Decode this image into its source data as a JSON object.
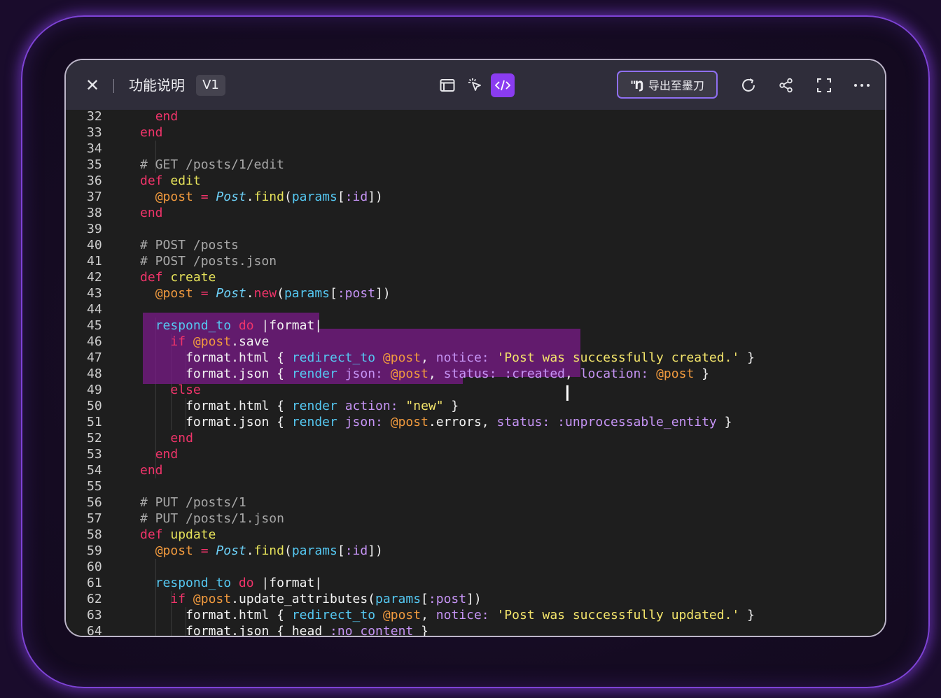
{
  "app": {
    "title": "功能说明",
    "version": "V1",
    "export_label": "导出至墨刀",
    "export_logo": "\"Ŋ",
    "close_glyph": "✕"
  },
  "toolbar_icons": [
    "preview-icon",
    "select-cursor-icon",
    "code-view-icon",
    "refresh-icon",
    "share-icon",
    "fullscreen-icon",
    "more-icon"
  ],
  "colors": {
    "accent": "#8a3cf0",
    "keyword": "#f0346a",
    "method": "#e6e25a",
    "instance_var": "#f19a3e",
    "constant": "#6ccff6",
    "comment": "#a8a8a8",
    "symbol": "#c694f5",
    "string": "#f4e56b",
    "hash_key": "#55c8f2",
    "selection": "#7d1a8c"
  },
  "code_lines": [
    {
      "n": "32",
      "indent": 2,
      "tokens": [
        [
          "kw",
          "end"
        ]
      ]
    },
    {
      "n": "33",
      "indent": 1,
      "tokens": [
        [
          "kw",
          "end"
        ]
      ]
    },
    {
      "n": "34",
      "indent": 0,
      "tokens": []
    },
    {
      "n": "35",
      "indent": 1,
      "tokens": [
        [
          "cm",
          "# GET /posts/1/edit"
        ]
      ]
    },
    {
      "n": "36",
      "indent": 1,
      "tokens": [
        [
          "kw",
          "def "
        ],
        [
          "fn",
          "edit"
        ]
      ]
    },
    {
      "n": "37",
      "indent": 2,
      "tokens": [
        [
          "iv",
          "@post"
        ],
        [
          "",
          " "
        ],
        [
          "kw",
          "="
        ],
        [
          "",
          " "
        ],
        [
          "cls",
          "Post"
        ],
        [
          "",
          "."
        ],
        [
          "fn",
          "find"
        ],
        [
          "",
          "("
        ],
        [
          "key",
          "params"
        ],
        [
          "",
          "["
        ],
        [
          "sym",
          ":id"
        ],
        [
          "",
          "])"
        ]
      ]
    },
    {
      "n": "38",
      "indent": 1,
      "tokens": [
        [
          "kw",
          "end"
        ]
      ]
    },
    {
      "n": "39",
      "indent": 0,
      "tokens": []
    },
    {
      "n": "40",
      "indent": 1,
      "tokens": [
        [
          "cm",
          "# POST /posts"
        ]
      ]
    },
    {
      "n": "41",
      "indent": 1,
      "tokens": [
        [
          "cm",
          "# POST /posts.json"
        ]
      ]
    },
    {
      "n": "42",
      "indent": 1,
      "tokens": [
        [
          "kw",
          "def "
        ],
        [
          "fn",
          "create"
        ]
      ]
    },
    {
      "n": "43",
      "indent": 2,
      "tokens": [
        [
          "iv",
          "@post"
        ],
        [
          "",
          " "
        ],
        [
          "kw",
          "="
        ],
        [
          "",
          " "
        ],
        [
          "cls",
          "Post"
        ],
        [
          "",
          "."
        ],
        [
          "kw",
          "new"
        ],
        [
          "",
          "("
        ],
        [
          "key",
          "params"
        ],
        [
          "",
          "["
        ],
        [
          "sym",
          ":post"
        ],
        [
          "",
          "])"
        ]
      ]
    },
    {
      "n": "44",
      "indent": 0,
      "tokens": []
    },
    {
      "n": "45",
      "indent": 2,
      "tokens": [
        [
          "key",
          "respond_to"
        ],
        [
          "",
          " "
        ],
        [
          "kw",
          "do"
        ],
        [
          "",
          " |format|"
        ]
      ]
    },
    {
      "n": "46",
      "indent": 3,
      "tokens": [
        [
          "kw",
          "if "
        ],
        [
          "iv",
          "@post"
        ],
        [
          "",
          "."
        ],
        [
          "",
          "save"
        ]
      ]
    },
    {
      "n": "47",
      "indent": 4,
      "tokens": [
        [
          "",
          "format"
        ],
        [
          "",
          "."
        ],
        [
          "",
          "html { "
        ],
        [
          "key",
          "redirect_to"
        ],
        [
          "",
          " "
        ],
        [
          "iv",
          "@post"
        ],
        [
          "",
          ", "
        ],
        [
          "sym",
          "notice:"
        ],
        [
          "",
          " "
        ],
        [
          "str",
          "'Post was successfully created.'"
        ],
        [
          "",
          " }"
        ]
      ]
    },
    {
      "n": "48",
      "indent": 4,
      "tokens": [
        [
          "",
          "format"
        ],
        [
          "",
          "."
        ],
        [
          "",
          "json { "
        ],
        [
          "key",
          "render"
        ],
        [
          "",
          " "
        ],
        [
          "sym",
          "json:"
        ],
        [
          "",
          " "
        ],
        [
          "iv",
          "@post"
        ],
        [
          "",
          ", "
        ],
        [
          "sym",
          "status:"
        ],
        [
          "",
          " "
        ],
        [
          "sym",
          ":created"
        ],
        [
          "",
          ", "
        ],
        [
          "sym",
          "location:"
        ],
        [
          "",
          " "
        ],
        [
          "iv",
          "@post"
        ],
        [
          "",
          " }"
        ]
      ]
    },
    {
      "n": "49",
      "indent": 3,
      "tokens": [
        [
          "kw",
          "else"
        ]
      ]
    },
    {
      "n": "50",
      "indent": 4,
      "tokens": [
        [
          "",
          "format"
        ],
        [
          "",
          "."
        ],
        [
          "",
          "html { "
        ],
        [
          "key",
          "render"
        ],
        [
          "",
          " "
        ],
        [
          "sym",
          "action:"
        ],
        [
          "",
          " "
        ],
        [
          "str",
          "\"new\""
        ],
        [
          "",
          " }"
        ]
      ]
    },
    {
      "n": "51",
      "indent": 4,
      "tokens": [
        [
          "",
          "format"
        ],
        [
          "",
          "."
        ],
        [
          "",
          "json { "
        ],
        [
          "key",
          "render"
        ],
        [
          "",
          " "
        ],
        [
          "sym",
          "json:"
        ],
        [
          "",
          " "
        ],
        [
          "iv",
          "@post"
        ],
        [
          "",
          ".errors, "
        ],
        [
          "sym",
          "status:"
        ],
        [
          "",
          " "
        ],
        [
          "sym",
          ":unprocessable_entity"
        ],
        [
          "",
          " }"
        ]
      ]
    },
    {
      "n": "52",
      "indent": 3,
      "tokens": [
        [
          "kw",
          "end"
        ]
      ]
    },
    {
      "n": "53",
      "indent": 2,
      "tokens": [
        [
          "kw",
          "end"
        ]
      ]
    },
    {
      "n": "54",
      "indent": 1,
      "tokens": [
        [
          "kw",
          "end"
        ]
      ]
    },
    {
      "n": "55",
      "indent": 0,
      "tokens": []
    },
    {
      "n": "56",
      "indent": 1,
      "tokens": [
        [
          "cm",
          "# PUT /posts/1"
        ]
      ]
    },
    {
      "n": "57",
      "indent": 1,
      "tokens": [
        [
          "cm",
          "# PUT /posts/1.json"
        ]
      ]
    },
    {
      "n": "58",
      "indent": 1,
      "tokens": [
        [
          "kw",
          "def "
        ],
        [
          "fn",
          "update"
        ]
      ]
    },
    {
      "n": "59",
      "indent": 2,
      "tokens": [
        [
          "iv",
          "@post"
        ],
        [
          "",
          " "
        ],
        [
          "kw",
          "="
        ],
        [
          "",
          " "
        ],
        [
          "cls",
          "Post"
        ],
        [
          "",
          "."
        ],
        [
          "fn",
          "find"
        ],
        [
          "",
          "("
        ],
        [
          "key",
          "params"
        ],
        [
          "",
          "["
        ],
        [
          "sym",
          ":id"
        ],
        [
          "",
          "])"
        ]
      ]
    },
    {
      "n": "60",
      "indent": 0,
      "tokens": []
    },
    {
      "n": "61",
      "indent": 2,
      "tokens": [
        [
          "key",
          "respond_to"
        ],
        [
          "",
          " "
        ],
        [
          "kw",
          "do"
        ],
        [
          "",
          " |format|"
        ]
      ]
    },
    {
      "n": "62",
      "indent": 3,
      "tokens": [
        [
          "kw",
          "if "
        ],
        [
          "iv",
          "@post"
        ],
        [
          "",
          "."
        ],
        [
          "",
          "update_attributes("
        ],
        [
          "key",
          "params"
        ],
        [
          "",
          "["
        ],
        [
          "sym",
          ":post"
        ],
        [
          "",
          "])"
        ]
      ]
    },
    {
      "n": "63",
      "indent": 4,
      "tokens": [
        [
          "",
          "format"
        ],
        [
          "",
          "."
        ],
        [
          "",
          "html { "
        ],
        [
          "key",
          "redirect_to"
        ],
        [
          "",
          " "
        ],
        [
          "iv",
          "@post"
        ],
        [
          "",
          ", "
        ],
        [
          "sym",
          "notice:"
        ],
        [
          "",
          " "
        ],
        [
          "str",
          "'Post was successfully updated.'"
        ],
        [
          "",
          " }"
        ]
      ]
    },
    {
      "n": "64",
      "indent": 4,
      "tokens": [
        [
          "",
          "format"
        ],
        [
          "",
          "."
        ],
        [
          "",
          "json { "
        ],
        [
          "",
          "head"
        ],
        [
          "",
          " "
        ],
        [
          "sym",
          ":no_content"
        ],
        [
          "",
          " }"
        ]
      ]
    }
  ]
}
